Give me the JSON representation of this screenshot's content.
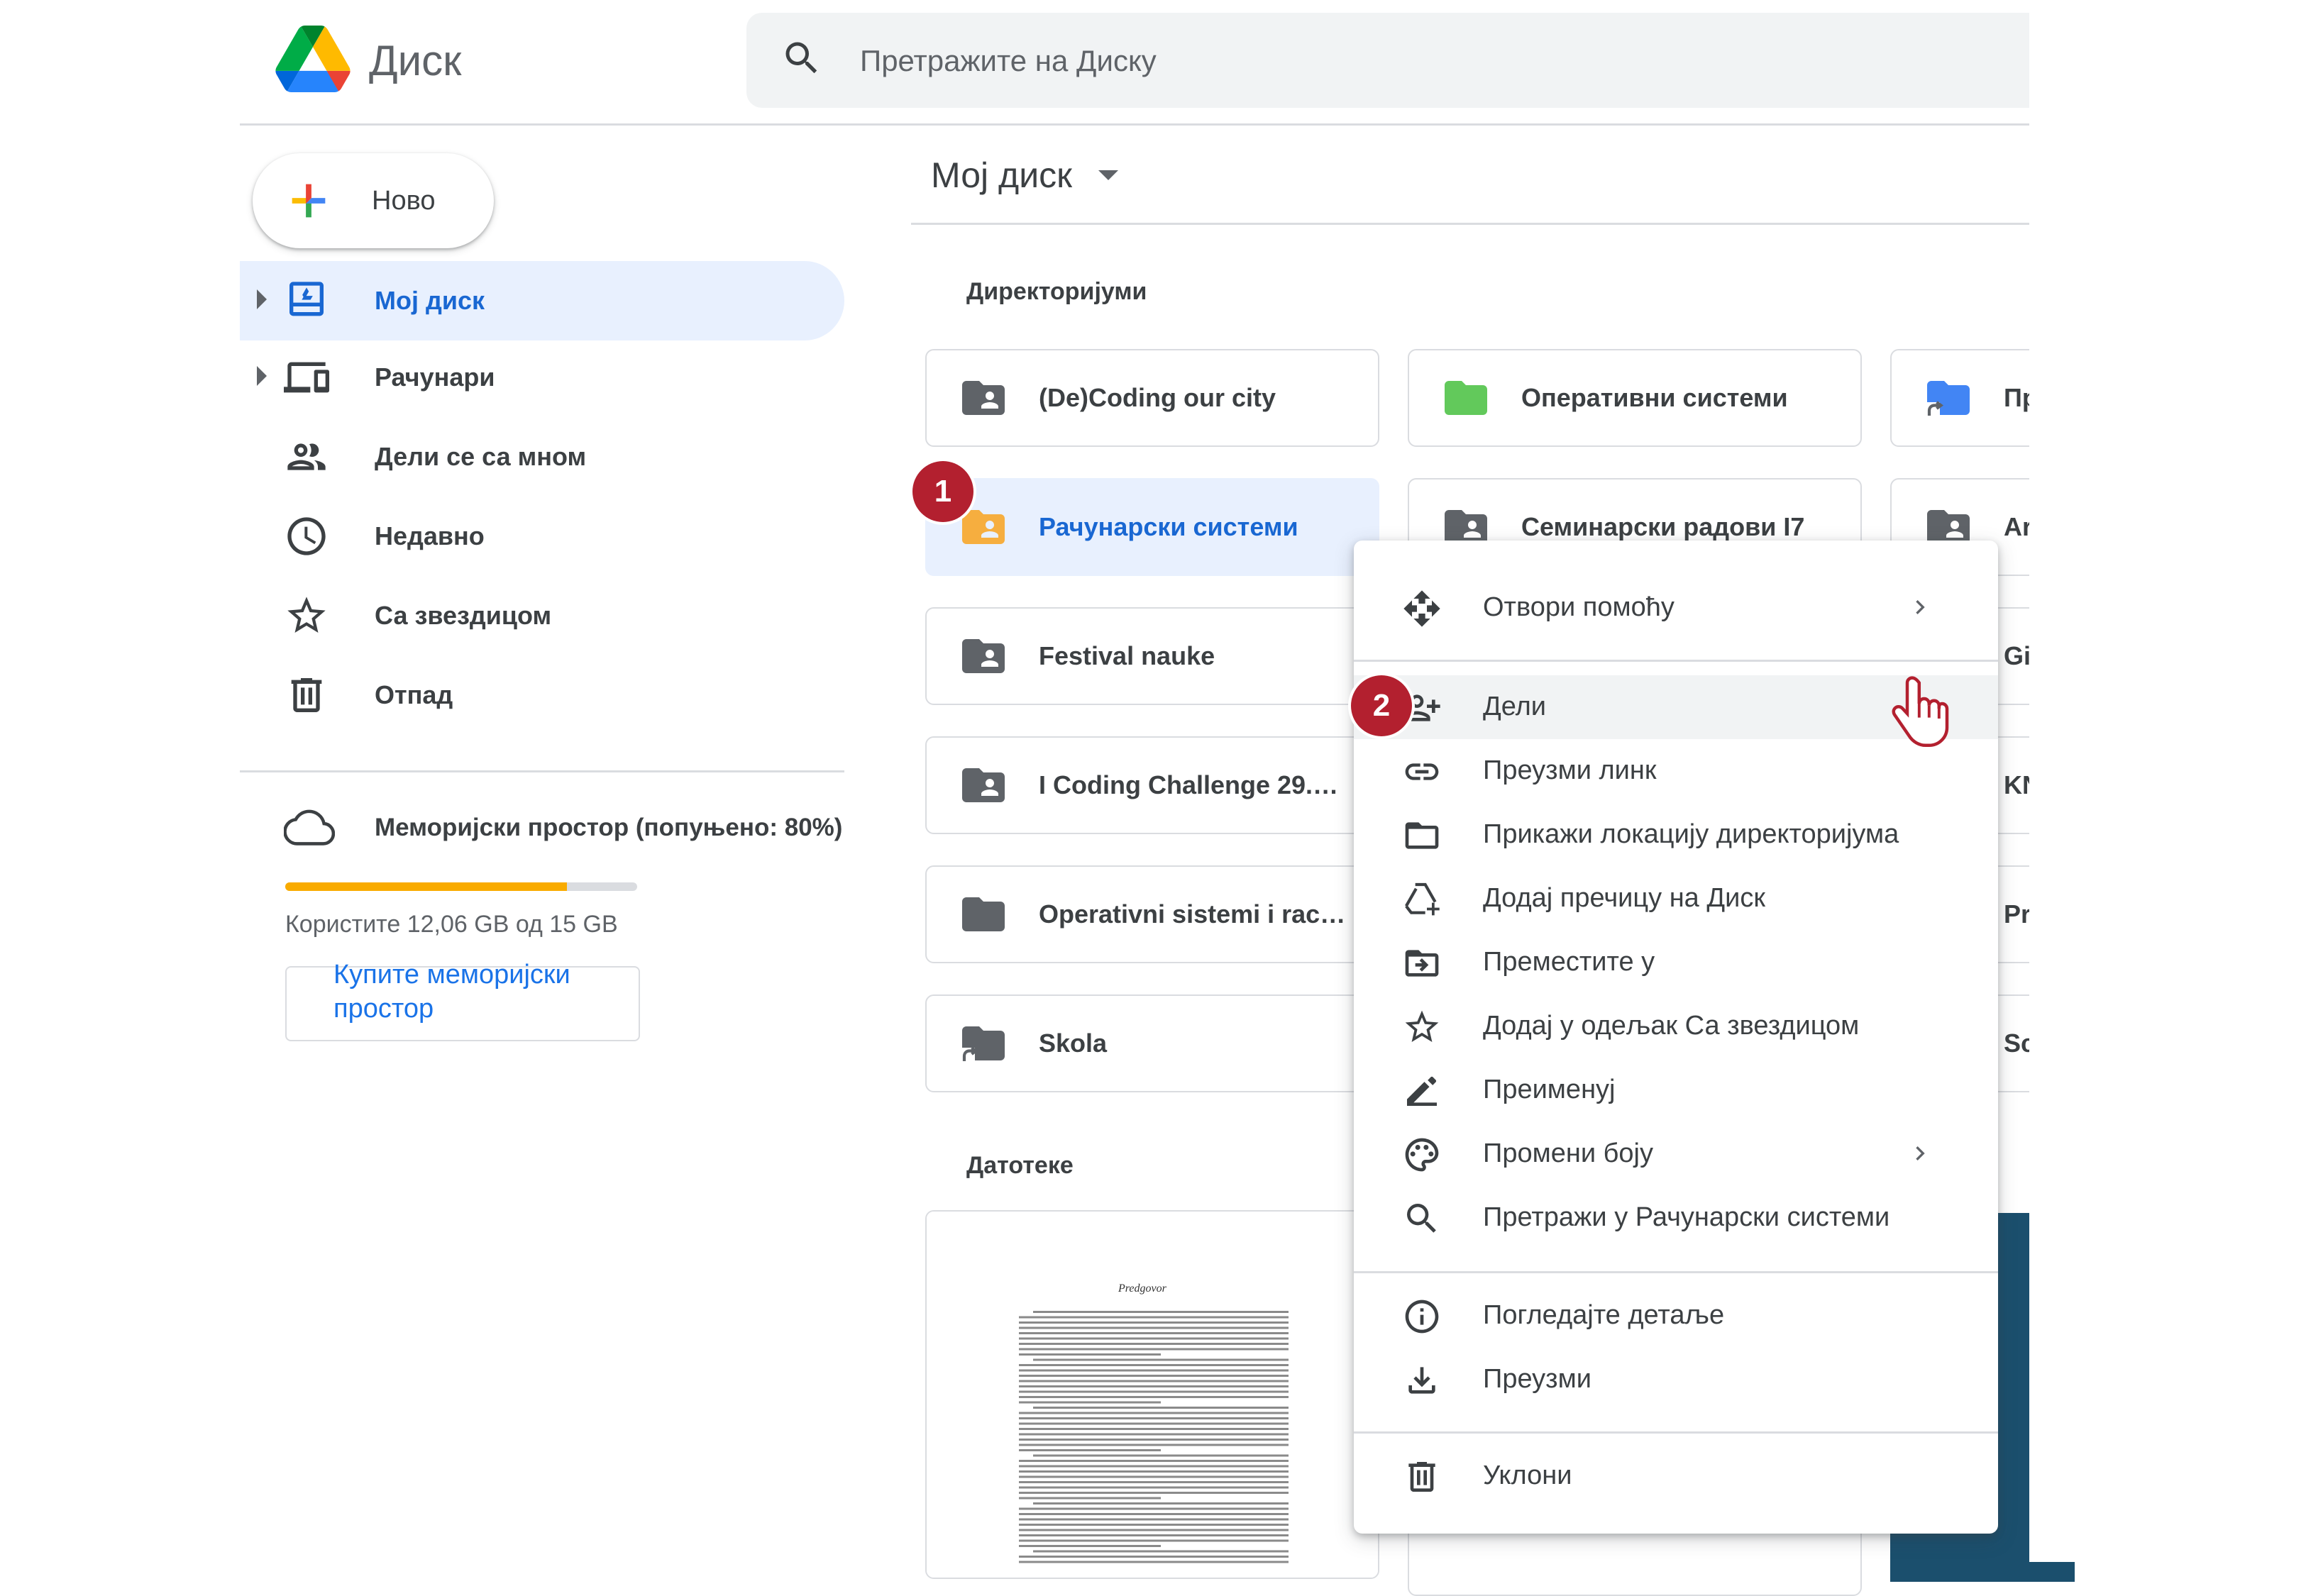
{
  "header": {
    "app_title": "Диск",
    "search_placeholder": "Претражите на Диску"
  },
  "sidebar": {
    "new_label": "Ново",
    "items": [
      {
        "label": "Мој диск",
        "icon": "my-drive-icon",
        "active": true
      },
      {
        "label": "Рачунари",
        "icon": "computers-icon"
      },
      {
        "label": "Дели се са мном",
        "icon": "shared-with-me-icon"
      },
      {
        "label": "Недавно",
        "icon": "recent-icon"
      },
      {
        "label": "Са звездицом",
        "icon": "star-icon"
      },
      {
        "label": "Отпад",
        "icon": "trash-icon"
      }
    ],
    "storage": {
      "title": "Меморијски простор (попуњено: 80%)",
      "used_fraction": 0.8,
      "usage_text": "Користите 12,06 GB од 15 GB",
      "buy_label": "Купите меморијски простор"
    }
  },
  "main": {
    "breadcrumb": "Мој диск",
    "folders_title": "Директоријуми",
    "files_title": "Датотеке",
    "folders": [
      {
        "name": "(De)Coding our city",
        "type": "shared"
      },
      {
        "name": "Оперативни системи",
        "type": "green"
      },
      {
        "name": "Пр",
        "type": "shortcut-blue"
      },
      {
        "name": "Рачунарски системи",
        "type": "shared-orange",
        "selected": true
      },
      {
        "name": "Семинарски радови I7",
        "type": "shared"
      },
      {
        "name": "Ar",
        "type": "shared"
      },
      {
        "name": "Festival nauke",
        "type": "shared"
      },
      {
        "name": "Gi",
        "type": "plain"
      },
      {
        "name": "I Coding Challenge 29.11...",
        "type": "shared"
      },
      {
        "name": "KN",
        "type": "plain"
      },
      {
        "name": "Operativni sistemi i racun...",
        "type": "plain"
      },
      {
        "name": "Pr",
        "type": "plain"
      },
      {
        "name": "Skola",
        "type": "shortcut"
      },
      {
        "name": "Sc",
        "type": "plain"
      }
    ],
    "file_preview_title": "Predgovor"
  },
  "context_menu": {
    "items": [
      {
        "label": "Отвори помоћу",
        "icon": "open-with-icon",
        "submenu": true
      },
      {
        "label": "Дели",
        "icon": "share-person-add-icon",
        "hover": true
      },
      {
        "label": "Преузми линк",
        "icon": "link-icon"
      },
      {
        "label": "Прикажи локацију директоријума",
        "icon": "folder-outline-icon"
      },
      {
        "label": "Додај пречицу на Диск",
        "icon": "add-shortcut-icon"
      },
      {
        "label": "Преместите у",
        "icon": "move-to-icon"
      },
      {
        "label": "Додај у одељак Са звездицом",
        "icon": "star-outline-icon"
      },
      {
        "label": "Преименуј",
        "icon": "rename-pencil-icon"
      },
      {
        "label": "Промени боју",
        "icon": "palette-icon",
        "submenu": true
      },
      {
        "label": "Претражи у Рачунарски системи",
        "icon": "search-icon"
      },
      {
        "label": "Погледајте детаље",
        "icon": "info-icon"
      },
      {
        "label": "Преузми",
        "icon": "download-icon"
      },
      {
        "label": "Уклони",
        "icon": "trash-icon"
      }
    ]
  },
  "callouts": [
    "1",
    "2"
  ],
  "colors": {
    "accent_blue": "#1967d2",
    "selected_bg": "#e8f0fe",
    "storage_fill": "#f9ab00",
    "callout": "#b3202f",
    "folder_orange": "#f6ae3f",
    "folder_green": "#62c95b",
    "folder_blue": "#4285f4"
  }
}
